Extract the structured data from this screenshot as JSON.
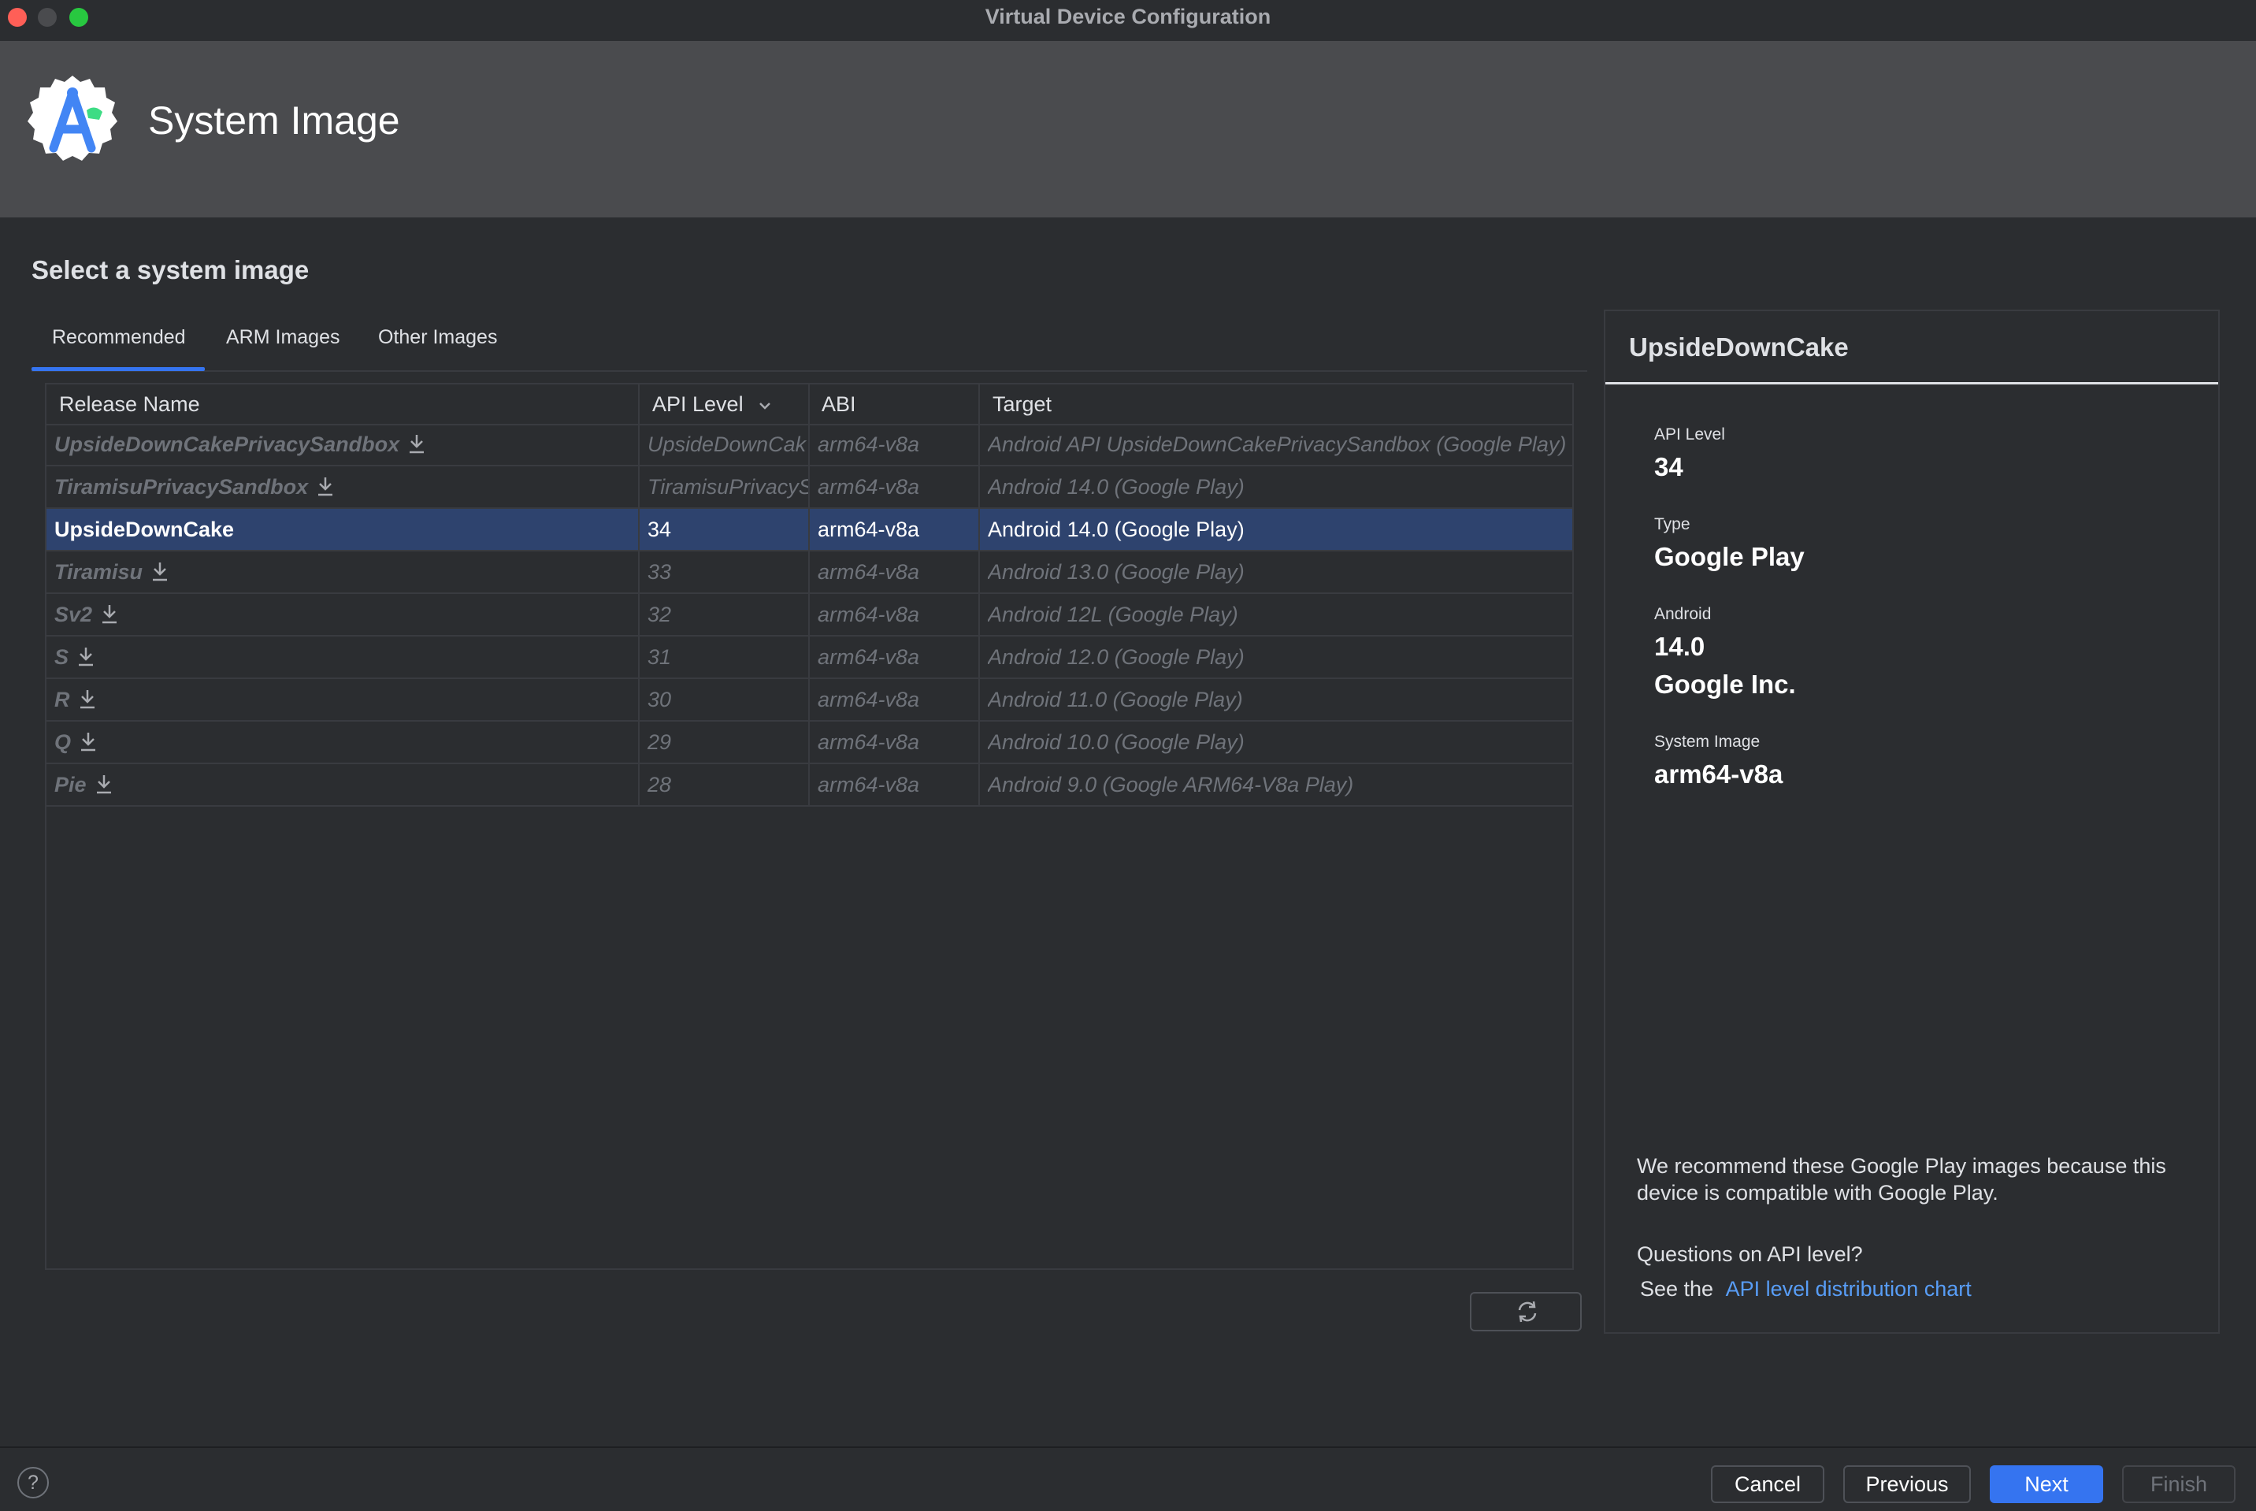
{
  "window": {
    "title": "Virtual Device Configuration"
  },
  "header": {
    "title": "System Image",
    "logo_icon": "android-studio-logo"
  },
  "section_title": "Select a system image",
  "tabs": [
    {
      "label": "Recommended",
      "active": true
    },
    {
      "label": "ARM Images",
      "active": false
    },
    {
      "label": "Other Images",
      "active": false
    }
  ],
  "table": {
    "columns": [
      "Release Name",
      "API Level",
      "ABI",
      "Target"
    ],
    "sort_column": "API Level",
    "rows": [
      {
        "name": "UpsideDownCakePrivacySandbox",
        "api": "UpsideDownCak",
        "abi": "arm64-v8a",
        "target": "Android API UpsideDownCakePrivacySandbox (Google Play)",
        "download": true,
        "selected": false
      },
      {
        "name": "TiramisuPrivacySandbox",
        "api": "TiramisuPrivacyS",
        "abi": "arm64-v8a",
        "target": "Android 14.0 (Google Play)",
        "download": true,
        "selected": false
      },
      {
        "name": "UpsideDownCake",
        "api": "34",
        "abi": "arm64-v8a",
        "target": "Android 14.0 (Google Play)",
        "download": false,
        "selected": true
      },
      {
        "name": "Tiramisu",
        "api": "33",
        "abi": "arm64-v8a",
        "target": "Android 13.0 (Google Play)",
        "download": true,
        "selected": false
      },
      {
        "name": "Sv2",
        "api": "32",
        "abi": "arm64-v8a",
        "target": "Android 12L (Google Play)",
        "download": true,
        "selected": false
      },
      {
        "name": "S",
        "api": "31",
        "abi": "arm64-v8a",
        "target": "Android 12.0 (Google Play)",
        "download": true,
        "selected": false
      },
      {
        "name": "R",
        "api": "30",
        "abi": "arm64-v8a",
        "target": "Android 11.0 (Google Play)",
        "download": true,
        "selected": false
      },
      {
        "name": "Q",
        "api": "29",
        "abi": "arm64-v8a",
        "target": "Android 10.0 (Google Play)",
        "download": true,
        "selected": false
      },
      {
        "name": "Pie",
        "api": "28",
        "abi": "arm64-v8a",
        "target": "Android 9.0 (Google ARM64-V8a Play)",
        "download": true,
        "selected": false
      }
    ]
  },
  "details": {
    "title": "UpsideDownCake",
    "api_level_label": "API Level",
    "api_level": "34",
    "type_label": "Type",
    "type": "Google Play",
    "android_label": "Android",
    "android_version": "14.0",
    "vendor": "Google Inc.",
    "system_image_label": "System Image",
    "system_image": "arm64-v8a",
    "recommend_line1": "We recommend these Google Play images because this",
    "recommend_line2": "device is compatible with Google Play.",
    "question": "Questions on API level?",
    "see_the": "See the",
    "link_text": "API level distribution chart"
  },
  "footer": {
    "help": "?",
    "cancel": "Cancel",
    "previous": "Previous",
    "next": "Next",
    "finish": "Finish"
  },
  "colors": {
    "accent": "#3574f0",
    "selection": "#2e436e",
    "link": "#589df6",
    "close": "#ff5f57",
    "minimize": "#4a4b4e",
    "zoom": "#28c840"
  }
}
